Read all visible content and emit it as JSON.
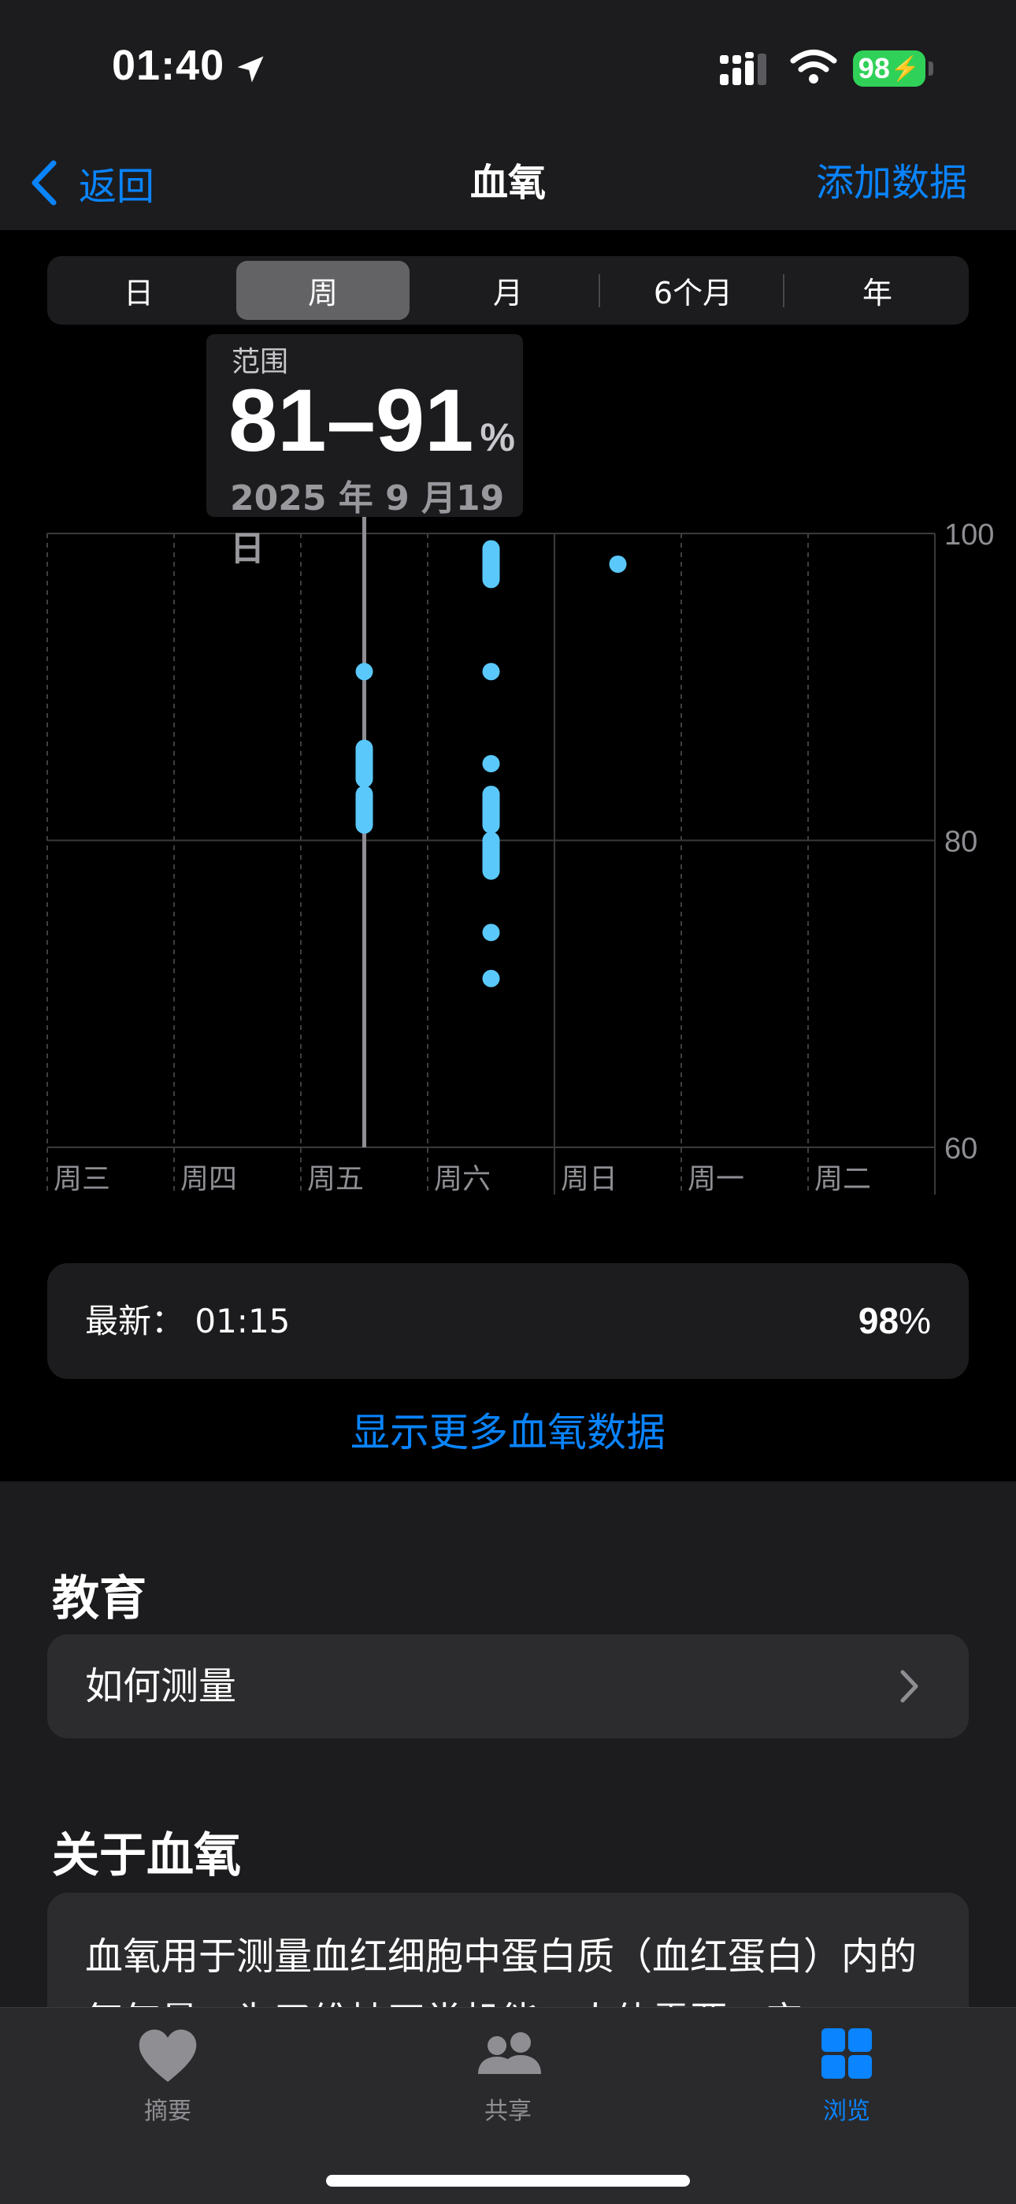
{
  "status_bar": {
    "time": "01:40",
    "battery": "98"
  },
  "nav": {
    "back_label": "返回",
    "title": "血氧",
    "add_label": "添加数据"
  },
  "segments": [
    {
      "label": "日",
      "selected": false
    },
    {
      "label": "周",
      "selected": true
    },
    {
      "label": "月",
      "selected": false
    },
    {
      "label": "6个月",
      "selected": false
    },
    {
      "label": "年",
      "selected": false
    }
  ],
  "tooltip": {
    "label": "范围",
    "value": "81–91",
    "unit": "%",
    "date": "2025 年 9 月19 日"
  },
  "chart_data": {
    "type": "scatter",
    "categories": [
      "周三",
      "周四",
      "周五",
      "周六",
      "周日",
      "周一",
      "周二"
    ],
    "ylim": [
      60,
      100
    ],
    "yticks": [
      100,
      80,
      60
    ],
    "selected_category": "周五",
    "points": [
      {
        "day": "周五",
        "low": 91,
        "high": 91
      },
      {
        "day": "周五",
        "low": 85,
        "high": 85
      },
      {
        "day": "周五",
        "low": 84,
        "high": 86
      },
      {
        "day": "周五",
        "low": 81,
        "high": 83
      },
      {
        "day": "周六",
        "low": 97,
        "high": 99
      },
      {
        "day": "周六",
        "low": 91,
        "high": 91
      },
      {
        "day": "周六",
        "low": 85,
        "high": 85
      },
      {
        "day": "周六",
        "low": 81,
        "high": 83
      },
      {
        "day": "周六",
        "low": 78,
        "high": 80
      },
      {
        "day": "周六",
        "low": 74,
        "high": 74
      },
      {
        "day": "周六",
        "low": 71,
        "high": 71
      },
      {
        "day": "周日",
        "low": 98,
        "high": 98
      }
    ],
    "point_color": "#5ac8fa",
    "grid": true
  },
  "latest": {
    "label": "最新：  01:15",
    "value": "98",
    "unit": "%"
  },
  "show_more_label": "显示更多血氧数据",
  "education": {
    "heading": "教育",
    "how_label": "如何测量"
  },
  "about": {
    "heading": "关于血氧",
    "text": "血氧用于测量血红细胞中蛋白质（血红蛋白）内的氧气量。为了维持正常机能，人体需要一定"
  },
  "tabs": [
    {
      "label": "摘要",
      "icon": "heart-icon",
      "active": false
    },
    {
      "label": "共享",
      "icon": "people-icon",
      "active": false
    },
    {
      "label": "浏览",
      "icon": "grid-icon",
      "active": true
    }
  ],
  "colors": {
    "accent": "#0a84ff",
    "data_point": "#5ac8fa",
    "battery": "#30d158"
  }
}
